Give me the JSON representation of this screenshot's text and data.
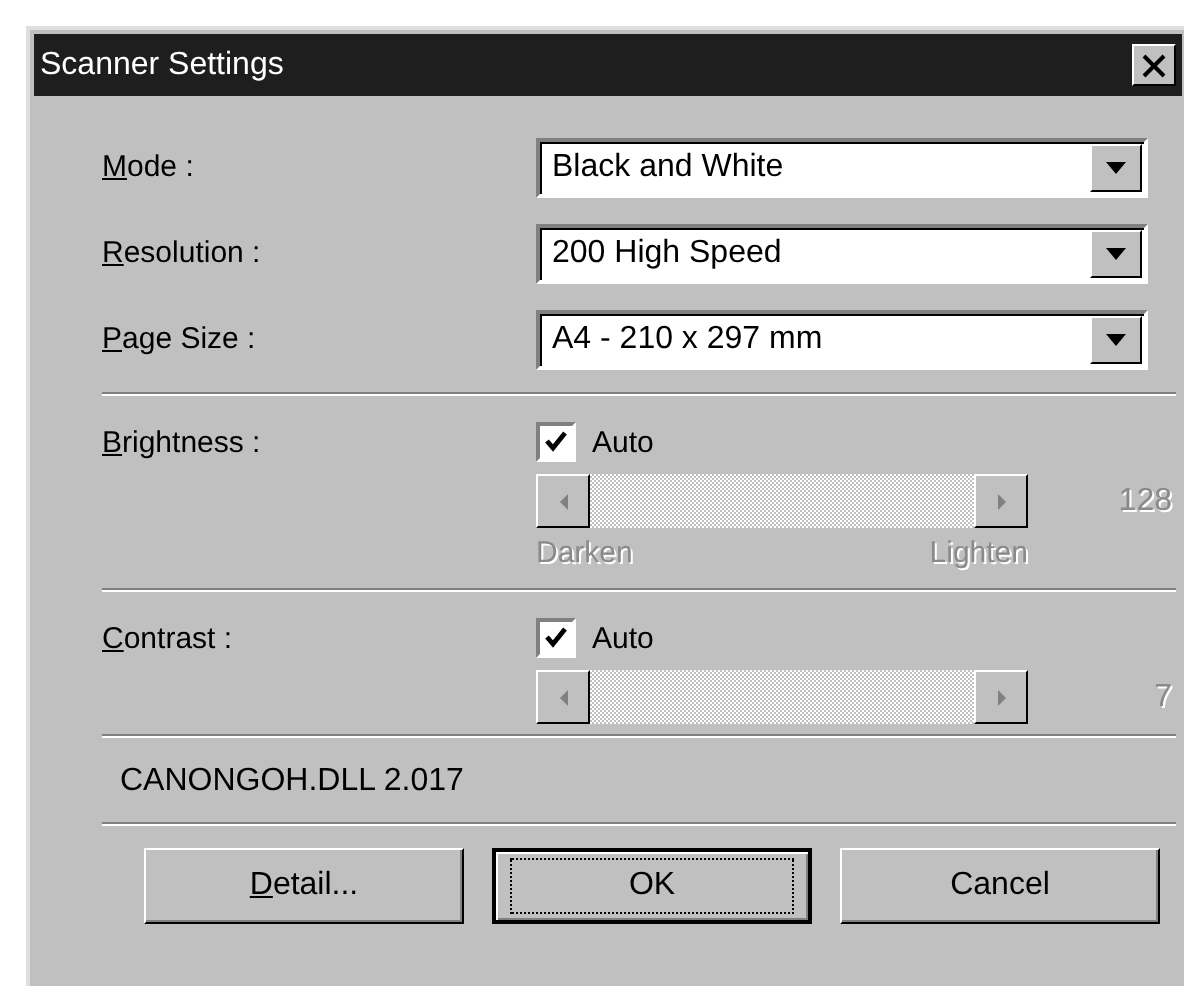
{
  "window": {
    "title": "Scanner Settings"
  },
  "selects": [
    {
      "label": "Mode :",
      "mnemonic": true,
      "value": "Black and White"
    },
    {
      "label": "Resolution :",
      "mnemonic": true,
      "value": "200 High Speed"
    },
    {
      "label": "Page Size :",
      "mnemonic": true,
      "value": "A4 - 210 x 297 mm"
    }
  ],
  "adjustments": [
    {
      "label": "Brightness :",
      "mnemonic": true,
      "auto_label": "Auto",
      "auto_checked": true,
      "disabled": true,
      "reading": "128",
      "min_label": "Darken",
      "max_label": "Lighten"
    },
    {
      "label": "Contrast :",
      "mnemonic": true,
      "auto_label": "Auto",
      "auto_checked": true,
      "disabled": true,
      "reading": "7"
    }
  ],
  "version": "CANONGOH.DLL 2.017",
  "buttons": [
    {
      "label": "Detail...",
      "mnemonic": true,
      "default": false
    },
    {
      "label": "OK",
      "mnemonic": false,
      "default": true
    },
    {
      "label": "Cancel",
      "mnemonic": false,
      "default": false
    }
  ]
}
